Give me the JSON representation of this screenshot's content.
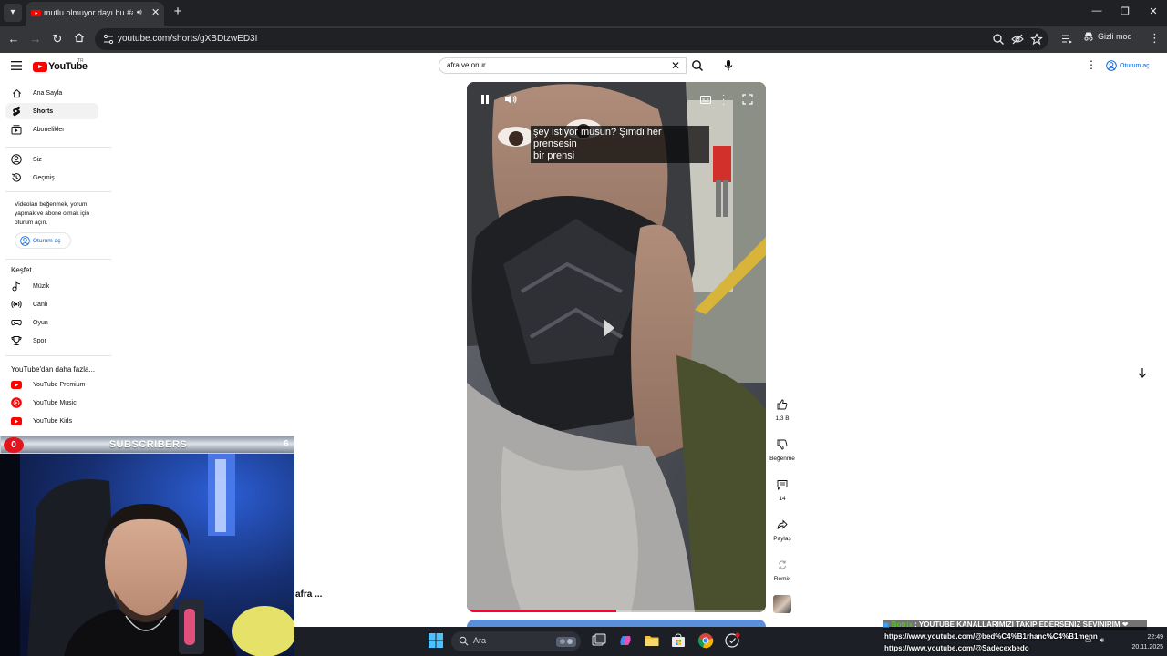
{
  "browser": {
    "tab_title": "mutlu olmuyor dayı bu #au",
    "url": "youtube.com/shorts/gXBDtzwED3I",
    "incognito_label": "Gizli mod"
  },
  "yt": {
    "logo_text": "YouTube",
    "country": "TR",
    "search_query": "afra ve onur",
    "signin_label": "Oturum aç"
  },
  "sidebar": {
    "main": [
      {
        "label": "Ana Sayfa",
        "icon": "home-icon"
      },
      {
        "label": "Shorts",
        "icon": "shorts-icon",
        "active": true
      },
      {
        "label": "Abonelikler",
        "icon": "subscriptions-icon"
      }
    ],
    "you": [
      {
        "label": "Siz",
        "icon": "account-icon"
      },
      {
        "label": "Geçmiş",
        "icon": "history-icon"
      }
    ],
    "signin_note": "Videoları beğenmek, yorum yapmak ve abone olmak için oturum açın.",
    "signin_label": "Oturum aç",
    "explore_title": "Keşfet",
    "explore": [
      {
        "label": "Müzik",
        "icon": "music-icon"
      },
      {
        "label": "Canlı",
        "icon": "live-icon"
      },
      {
        "label": "Oyun",
        "icon": "gaming-icon"
      },
      {
        "label": "Spor",
        "icon": "trophy-icon"
      }
    ],
    "more_title": "YouTube'dan daha fazla...",
    "more": [
      {
        "label": "YouTube Premium",
        "icon": "youtube-premium-icon"
      },
      {
        "label": "YouTube Music",
        "icon": "youtube-music-icon"
      },
      {
        "label": "YouTube Kids",
        "icon": "youtube-kids-icon"
      }
    ]
  },
  "video": {
    "caption_line1": "şey istiyor musun? Şimdi her prensesin",
    "caption_line2": "bir prensi",
    "progress": 0.5,
    "partial_title": "afra ..."
  },
  "actions": {
    "likes": "1,3 B",
    "dislike": "Beğenme",
    "comments": "14",
    "share": "Paylaş",
    "remix": "Remix"
  },
  "overlay": {
    "subscribers_count": "0",
    "subscribers_label": "SUBSCRIBERS",
    "subscribers_goal": "6"
  },
  "taskbar": {
    "search_placeholder": "Ara",
    "time": "22:49",
    "date": "20.11.2025"
  },
  "chat": {
    "user": "Botrix",
    "message": ": YOUTUBE KANALLARIMIZI TAKIP EDERSENIZ SEVINIRIM ❤",
    "link1": "https://www.youtube.com/@bed%C4%B1rhanc%C4%B1menn",
    "link2": "https://www.youtube.com/@Sadecexbedo"
  },
  "colors": {
    "brand_red": "#ff0000",
    "link_blue": "#065fd4",
    "chrome_dark": "#202124",
    "chat_user": "#52c41a"
  }
}
